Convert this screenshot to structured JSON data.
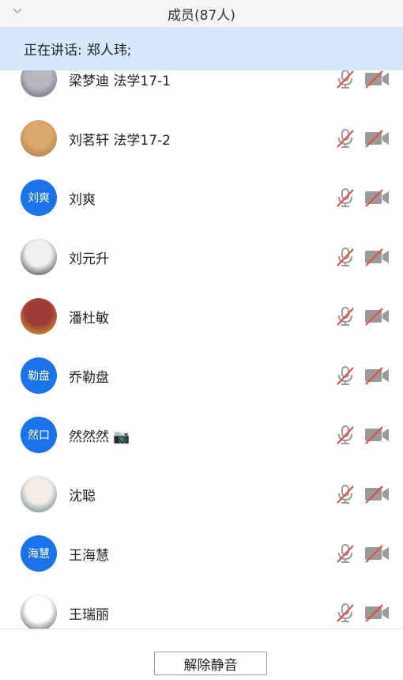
{
  "header": {
    "title": "成员(87人)"
  },
  "speaking": {
    "label": "正在讲话:",
    "speaker": "郑人玮;"
  },
  "members": [
    {
      "name": "梁梦迪 法学17-1",
      "avatar_type": "photo",
      "avatar_colors": [
        "#b7b7c2",
        "#5a5a6a"
      ]
    },
    {
      "name": "刘茗轩 法学17-2",
      "avatar_type": "photo",
      "avatar_colors": [
        "#d9a86a",
        "#a6703a"
      ]
    },
    {
      "name": "刘爽",
      "avatar_type": "text",
      "avatar_text": "刘爽"
    },
    {
      "name": "刘元升",
      "avatar_type": "photo",
      "avatar_colors": [
        "#f0f0f0",
        "#1a1a1a"
      ]
    },
    {
      "name": "潘杜敏",
      "avatar_type": "photo",
      "avatar_colors": [
        "#9e3b36",
        "#e3b43a"
      ]
    },
    {
      "name": "乔勒盘",
      "avatar_type": "text",
      "avatar_text": "勒盘"
    },
    {
      "name": "然然然 📷",
      "avatar_type": "text",
      "avatar_text": "然口"
    },
    {
      "name": "沈聪",
      "avatar_type": "photo",
      "avatar_colors": [
        "#f4ece6",
        "#3a6f6a"
      ]
    },
    {
      "name": "王海慧",
      "avatar_type": "text",
      "avatar_text": "海慧"
    },
    {
      "name": "王瑞丽",
      "avatar_type": "photo",
      "avatar_colors": [
        "#ffffff",
        "#333333"
      ]
    }
  ],
  "footer": {
    "unmute_label": "解除静音"
  },
  "colors": {
    "accent": "#1a73e8",
    "speaking_bg": "#d6e8fd",
    "muted_slash": "#e84c3d",
    "icon_gray": "#9a9a9a"
  }
}
